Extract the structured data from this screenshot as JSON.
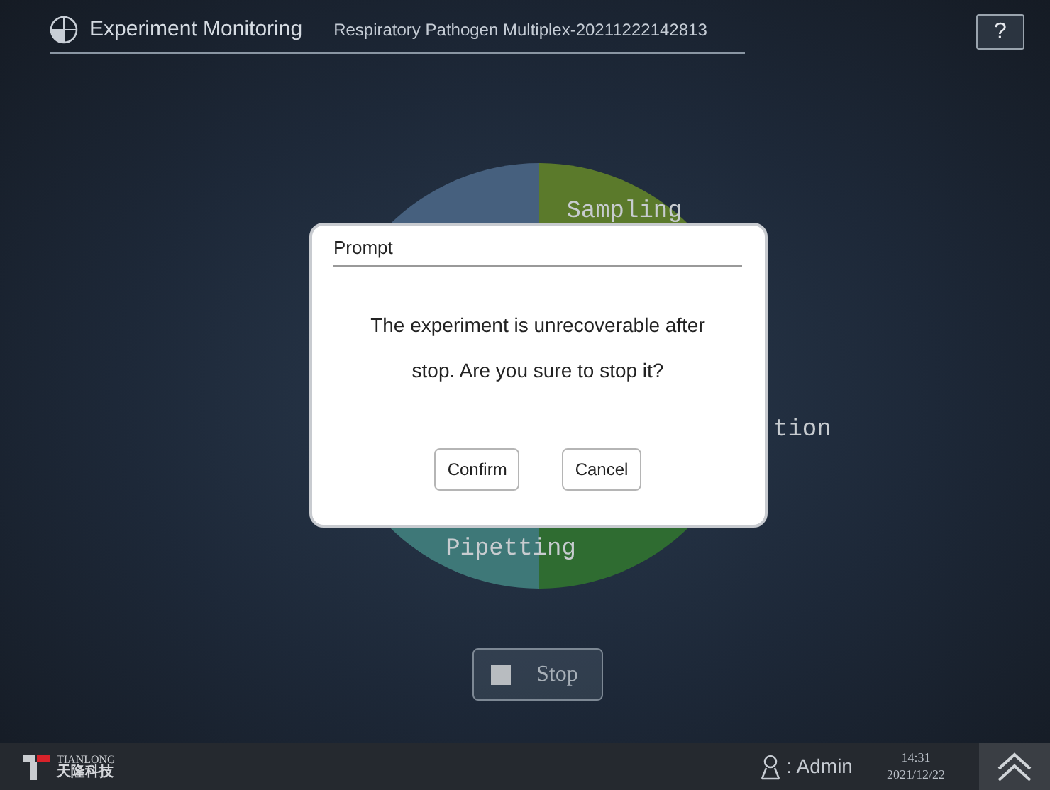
{
  "header": {
    "title": "Experiment Monitoring",
    "experiment": "Respiratory Pathogen Multiplex-20211222142813",
    "help": "?"
  },
  "progress_pie": {
    "segments": [
      {
        "color": "#5b7a2b",
        "label": "Sampling"
      },
      {
        "color": "#2f6c31",
        "label": "tion"
      },
      {
        "color": "#3e7878",
        "label": "Pipetting"
      },
      {
        "color": "#46607e"
      }
    ]
  },
  "stop_button": {
    "label": "Stop"
  },
  "dialog": {
    "title": "Prompt",
    "message": "The experiment is unrecoverable after stop. Are you sure to stop it?",
    "buttons": [
      "Confirm",
      "Cancel"
    ]
  },
  "footer": {
    "logo_en": "TIANLONG",
    "logo_cn": "天隆科技",
    "user": ": Admin",
    "time": "14:31",
    "date": "2021/12/22"
  }
}
